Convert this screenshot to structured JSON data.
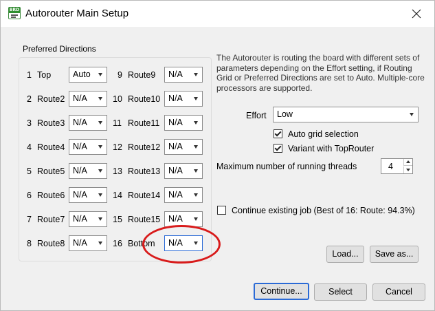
{
  "window": {
    "title": "Autorouter Main Setup",
    "app_icon_text": "BRD"
  },
  "preferred_directions": {
    "title": "Preferred Directions",
    "layers": [
      {
        "num": "1",
        "name": "Top",
        "value": "Auto"
      },
      {
        "num": "2",
        "name": "Route2",
        "value": "N/A"
      },
      {
        "num": "3",
        "name": "Route3",
        "value": "N/A"
      },
      {
        "num": "4",
        "name": "Route4",
        "value": "N/A"
      },
      {
        "num": "5",
        "name": "Route5",
        "value": "N/A"
      },
      {
        "num": "6",
        "name": "Route6",
        "value": "N/A"
      },
      {
        "num": "7",
        "name": "Route7",
        "value": "N/A"
      },
      {
        "num": "8",
        "name": "Route8",
        "value": "N/A"
      },
      {
        "num": "9",
        "name": "Route9",
        "value": "N/A"
      },
      {
        "num": "10",
        "name": "Route10",
        "value": "N/A"
      },
      {
        "num": "11",
        "name": "Route11",
        "value": "N/A"
      },
      {
        "num": "12",
        "name": "Route12",
        "value": "N/A"
      },
      {
        "num": "13",
        "name": "Route13",
        "value": "N/A"
      },
      {
        "num": "14",
        "name": "Route14",
        "value": "N/A"
      },
      {
        "num": "15",
        "name": "Route15",
        "value": "N/A"
      },
      {
        "num": "16",
        "name": "Bottom",
        "value": "N/A"
      }
    ]
  },
  "description": "The Autorouter is routing the board with different sets of parameters depending on the Effort setting, if Routing Grid or Preferred Directions are set to Auto. Multiple-core processors are supported.",
  "effort": {
    "label": "Effort",
    "value": "Low"
  },
  "options": {
    "auto_grid": {
      "label": "Auto grid selection",
      "checked": true
    },
    "variant_toprouter": {
      "label": "Variant with TopRouter",
      "checked": true
    }
  },
  "threads": {
    "label": "Maximum number of running threads",
    "value": "4"
  },
  "continue_job": {
    "label": "Continue existing job (Best of 16: Route: 94.3%)",
    "checked": false
  },
  "buttons": {
    "load": "Load...",
    "save_as": "Save as...",
    "continue": "Continue...",
    "select": "Select",
    "cancel": "Cancel"
  },
  "colors": {
    "focus_border": "#2a6ad6",
    "annotation_red": "#d81b1b"
  }
}
